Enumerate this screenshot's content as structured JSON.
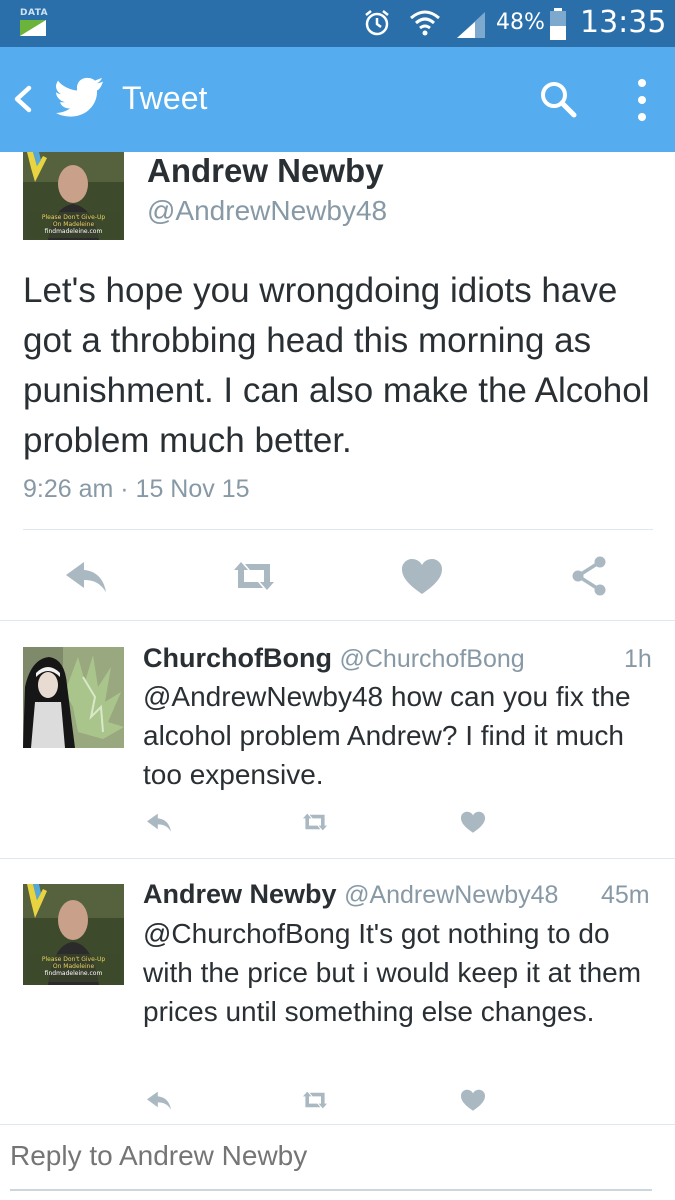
{
  "status_bar": {
    "data_label": "DATA",
    "battery_percent": "48%",
    "time": "13:35",
    "icons": [
      "data-icon",
      "alarm-icon",
      "wifi-icon",
      "signal-icon",
      "battery-icon"
    ]
  },
  "app_bar": {
    "title": "Tweet",
    "color": "#55acee",
    "icons": [
      "back-icon",
      "twitter-bird-icon",
      "search-icon",
      "more-vert-icon"
    ]
  },
  "main_tweet": {
    "name": "Andrew Newby",
    "handle": "@AndrewNewby48",
    "avatar_caption": [
      "Please Don't Give-Up",
      "On Madeleine",
      "findmadeleine.com"
    ],
    "text": "Let's hope you wrongdoing idiots have got a throbbing head this morning as punishment. I can also make the Alcohol problem much better.",
    "meta": "9:26 am · 15 Nov 15",
    "actions": [
      "reply-icon",
      "retweet-icon",
      "like-icon",
      "share-icon"
    ]
  },
  "replies": [
    {
      "name": "ChurchofBong",
      "handle": "@ChurchofBong",
      "time": "1h",
      "text": "@AndrewNewby48 how can you fix the alcohol problem Andrew? I find it much too expensive."
    },
    {
      "name": "Andrew Newby",
      "handle": "@AndrewNewby48",
      "time": "45m",
      "text": "@ChurchofBong It's got nothing to do with the price but i would keep it at them prices until something else changes.",
      "avatar_caption": [
        "Please Don't Give-Up",
        "On Madeleine",
        "findmadeleine.com"
      ]
    }
  ],
  "reply_box": {
    "placeholder": "Reply to Andrew Newby"
  }
}
